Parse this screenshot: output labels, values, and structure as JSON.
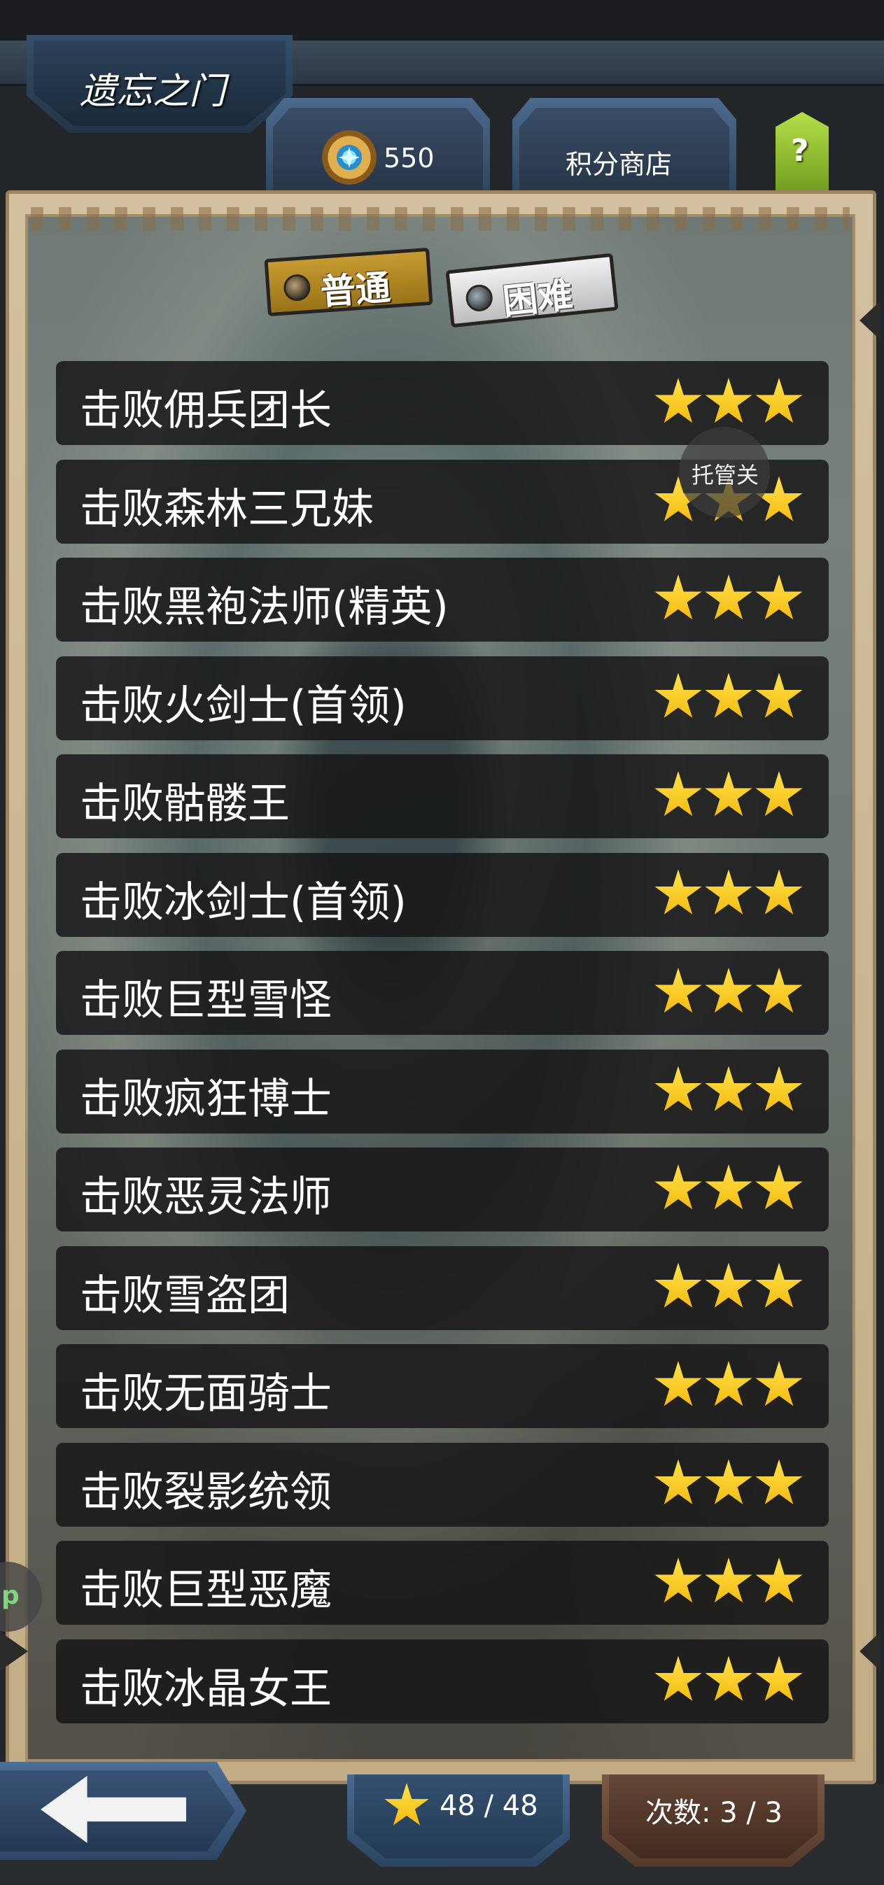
{
  "header": {
    "title": "遗忘之门",
    "currency_value": "550",
    "shop_label": "积分商店",
    "help_label": "?"
  },
  "difficulty": {
    "normal_label": "普通",
    "hard_label": "困难",
    "selected": "普通"
  },
  "floating_label": "托管关",
  "side_label": "p",
  "challenges": [
    {
      "name": "击败佣兵团长",
      "stars": 3
    },
    {
      "name": "击败森林三兄妹",
      "stars": 3
    },
    {
      "name": "击败黑袍法师(精英)",
      "stars": 3
    },
    {
      "name": "击败火剑士(首领)",
      "stars": 3
    },
    {
      "name": "击败骷髅王",
      "stars": 3
    },
    {
      "name": "击败冰剑士(首领)",
      "stars": 3
    },
    {
      "name": "击败巨型雪怪",
      "stars": 3
    },
    {
      "name": "击败疯狂博士",
      "stars": 3
    },
    {
      "name": "击败恶灵法师",
      "stars": 3
    },
    {
      "name": "击败雪盗团",
      "stars": 3
    },
    {
      "name": "击败无面骑士",
      "stars": 3
    },
    {
      "name": "击败裂影统领",
      "stars": 3
    },
    {
      "name": "击败巨型恶魔",
      "stars": 3
    },
    {
      "name": "击败冰晶女王",
      "stars": 3
    }
  ],
  "footer": {
    "star_count": "48 / 48",
    "tries": "次数: 3 / 3"
  },
  "colors": {
    "star": "#f6c21a",
    "normal_tab": "#c79b31",
    "hard_tab": "#d8d8d8",
    "help_button": "#8fbf2a"
  },
  "icons": {
    "currency": "gem-medal-icon",
    "back": "arrow-left-icon",
    "star": "star-icon"
  }
}
